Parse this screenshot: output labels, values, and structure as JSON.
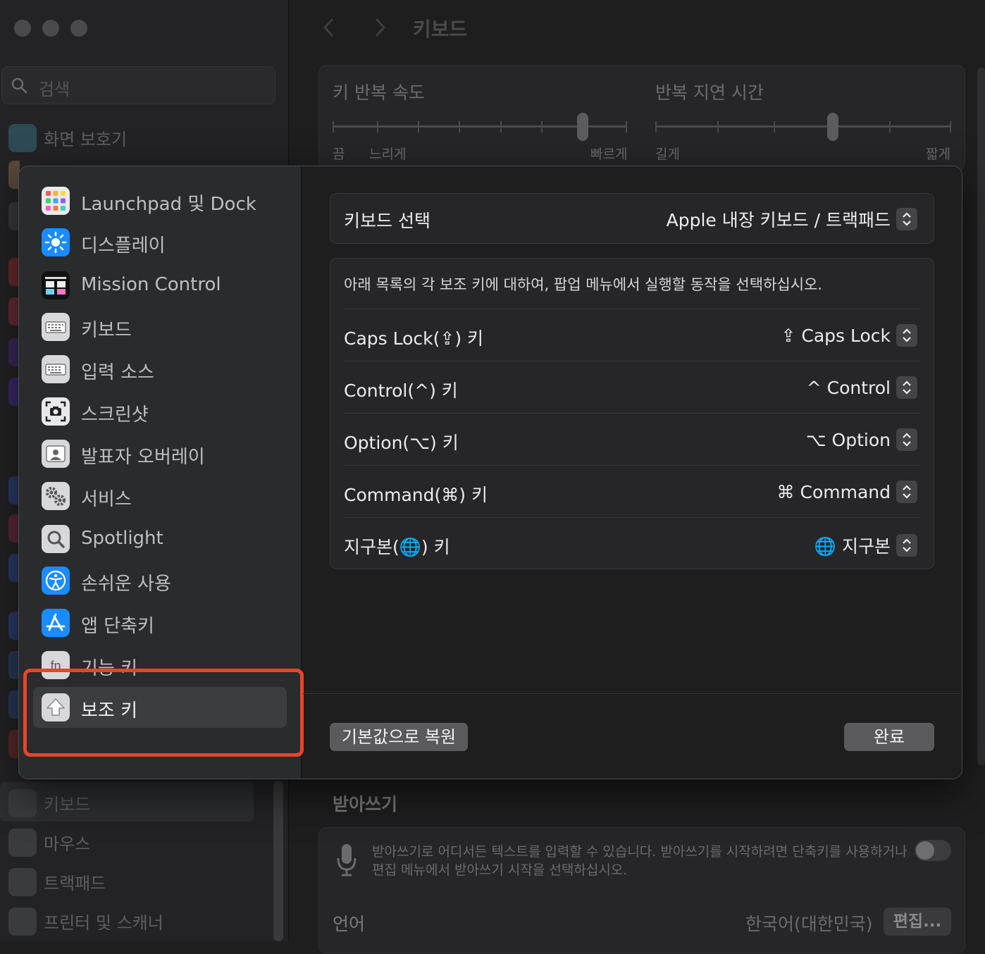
{
  "background": {
    "search_placeholder": "검색",
    "sidebar_items": [
      {
        "label": "화면 보호기"
      },
      {
        "label": "키보드"
      },
      {
        "label": "마우스"
      },
      {
        "label": "트랙패드"
      },
      {
        "label": "프린터 및 스캐너"
      }
    ],
    "title": "키보드",
    "key_repeat_title": "키 반복 속도",
    "key_repeat_labels": [
      "끔",
      "느리게",
      "빠르게"
    ],
    "repeat_delay_title": "반복 지연 시간",
    "repeat_delay_labels": [
      "길게",
      "짧게"
    ],
    "key_repeat_level": 0.85,
    "repeat_delay_level": 0.6,
    "dictation_title": "받아쓰기",
    "dictation_line1": "받아쓰기로 어디서든 텍스트를 입력할 수 있습니다. 받아쓰기를 시작하려면 단축키를 사용하거나",
    "dictation_line2": "편집 메뉴에서 받아쓰기 시작을 선택하십시오.",
    "language_label": "언어",
    "language_value": "한국어(대한민국)",
    "edit_button": "편집..."
  },
  "sheet": {
    "sidebar_items": [
      {
        "label": "Launchpad 및 Dock",
        "icon": "launchpad-icon"
      },
      {
        "label": "디스플레이",
        "icon": "display-icon"
      },
      {
        "label": "Mission Control",
        "icon": "mission-control-icon"
      },
      {
        "label": "키보드",
        "icon": "keyboard-icon"
      },
      {
        "label": "입력 소스",
        "icon": "input-source-icon"
      },
      {
        "label": "스크린샷",
        "icon": "screenshot-icon"
      },
      {
        "label": "발표자 오버레이",
        "icon": "presenter-overlay-icon"
      },
      {
        "label": "서비스",
        "icon": "services-icon"
      },
      {
        "label": "Spotlight",
        "icon": "spotlight-icon"
      },
      {
        "label": "손쉬운 사용",
        "icon": "accessibility-icon"
      },
      {
        "label": "앱 단축키",
        "icon": "app-shortcuts-icon"
      },
      {
        "label": "기능 키",
        "icon": "fn-key-icon"
      },
      {
        "label": "보조 키",
        "icon": "modifier-keys-icon",
        "selected": true
      }
    ],
    "keyboard_select_label": "키보드 선택",
    "keyboard_select_value": "Apple 내장 키보드 / 트랙패드",
    "description": "아래 목록의 각 보조 키에 대하여, 팝업 메뉴에서 실행할 동작을 선택하십시오.",
    "modifier_rows": [
      {
        "label": "Caps Lock(⇪) 키",
        "value": "⇪ Caps Lock"
      },
      {
        "label": "Control(^) 키",
        "value": "^ Control"
      },
      {
        "label": "Option(⌥) 키",
        "value": "⌥ Option"
      },
      {
        "label": "Command(⌘) 키",
        "value": "⌘ Command"
      },
      {
        "label": "지구본(🌐) 키",
        "value": "🌐 지구본"
      }
    ],
    "restore_defaults_button": "기본값으로 복원",
    "done_button": "완료",
    "colors": {
      "highlight": "#e8442a"
    }
  }
}
